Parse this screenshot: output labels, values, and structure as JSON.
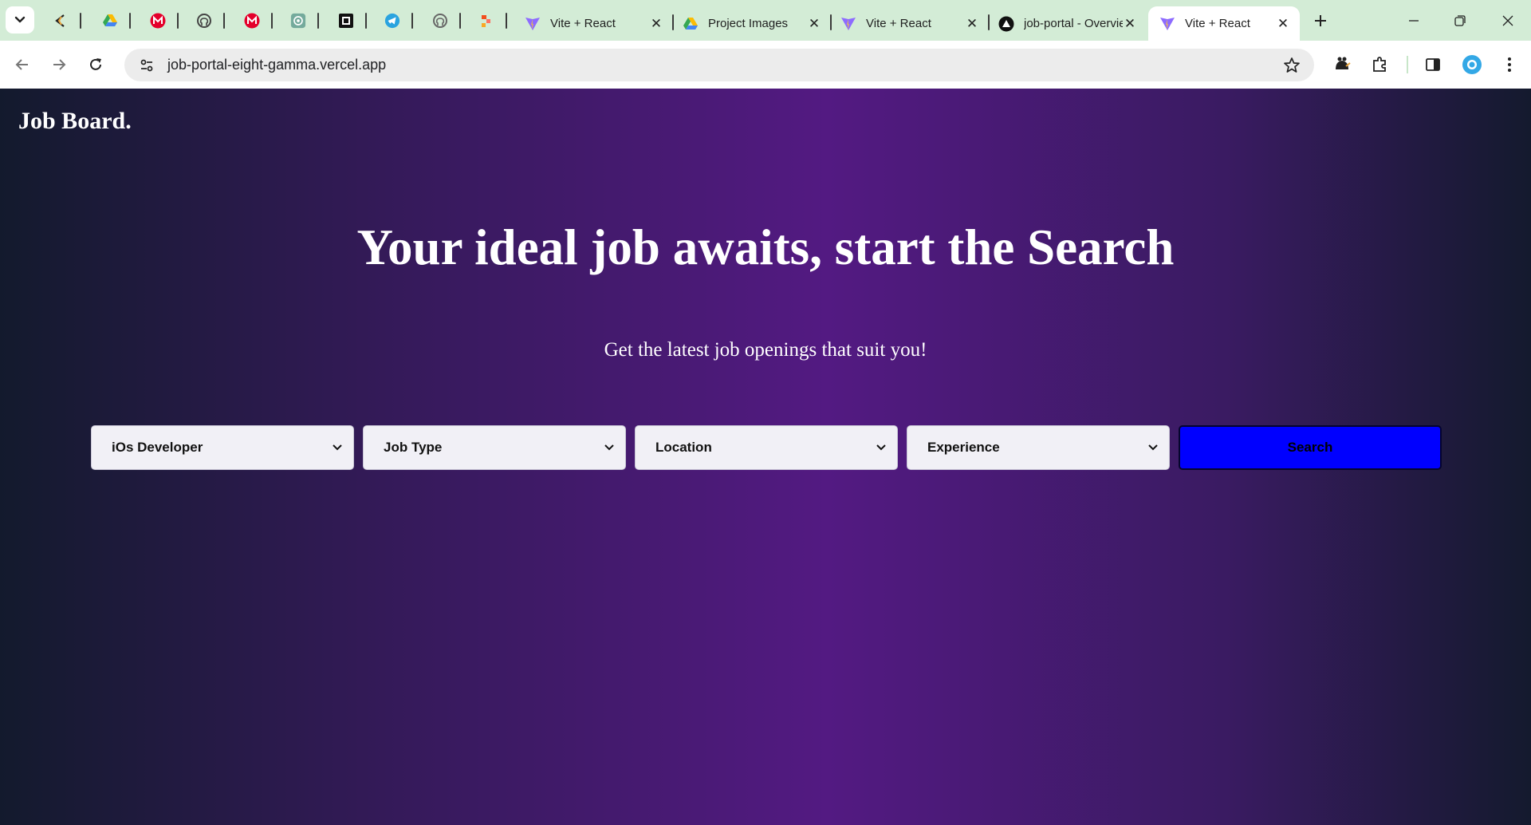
{
  "browser": {
    "tabs": [
      {
        "title": "Vite + React",
        "icon": "vite-icon"
      },
      {
        "title": "Project Images",
        "icon": "google-drive-icon"
      },
      {
        "title": "Vite + React",
        "icon": "vite-icon"
      },
      {
        "title": "job-portal - Overview",
        "icon": "vercel-icon"
      },
      {
        "title": "Vite + React",
        "icon": "vite-icon"
      }
    ],
    "pinned_tabs": [
      "claude-icon",
      "google-drive-icon",
      "gmail-icon",
      "github-icon",
      "gmail-icon",
      "chatgpt-icon",
      "notion-icon",
      "telegram-icon",
      "github-icon",
      "figma-icon"
    ],
    "address": "job-portal-eight-gamma.vercel.app",
    "active_tab_index": 4
  },
  "colors": {
    "tabstrip_bg": "#d3ecd6",
    "search_button": "#0000ff",
    "page_gradient_center": "#531a82",
    "page_gradient_edge": "#131a2d"
  },
  "page": {
    "brand": "Job Board.",
    "hero_title": "Your ideal job awaits, start the Search",
    "hero_subtitle": "Get the latest job openings that suit you!",
    "filters": {
      "role": "iOs Developer",
      "job_type": "Job Type",
      "location": "Location",
      "experience": "Experience"
    },
    "search_label": "Search"
  }
}
